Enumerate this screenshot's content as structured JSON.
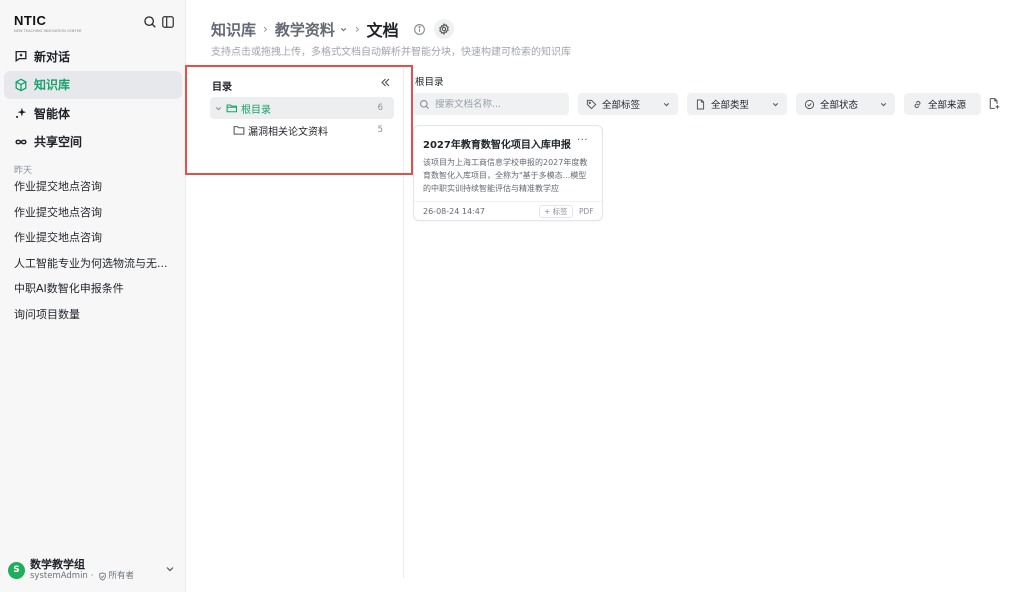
{
  "app": {
    "logo_text": "NTIC",
    "logo_tagline": "NEW TEACHING INNOVATION CENTER"
  },
  "nav": {
    "items": [
      {
        "label": "新对话",
        "icon": "chat-icon"
      },
      {
        "label": "知识库",
        "icon": "cube-icon",
        "active": true
      },
      {
        "label": "智能体",
        "icon": "sparkle-icon"
      },
      {
        "label": "共享空间",
        "icon": "infinity-icon"
      }
    ]
  },
  "history": {
    "group_label": "昨天",
    "items": [
      "作业提交地点咨询",
      "作业提交地点咨询",
      "作业提交地点咨询",
      "人工智能专业为何选物流与无...",
      "中职AI数智化申报条件",
      "询问项目数量"
    ]
  },
  "user": {
    "avatar_letter": "S",
    "name": "数学教学组",
    "account": "systemAdmin",
    "separator": "·",
    "role": "所有者"
  },
  "header": {
    "crumb_root": "知识库",
    "crumb_mid": "教学资料",
    "crumb_current": "文档",
    "subtitle": "支持点击或拖拽上传，多格式文档自动解析并智能分块，快速构建可检索的知识库"
  },
  "directory": {
    "title": "目录",
    "tree": [
      {
        "label": "根目录",
        "count": "6",
        "selected": true
      },
      {
        "label": "漏洞相关论文资料",
        "count": "5"
      }
    ]
  },
  "content": {
    "path_label": "根目录",
    "search_placeholder": "搜索文档名称...",
    "filters": [
      "全部标签",
      "全部类型",
      "全部状态",
      "全部来源"
    ]
  },
  "documents": [
    {
      "title": "2027年教育数智化项目入库申报",
      "more": "···",
      "description": "该项目为上海工商信息学校申报的2027年度教育数智化入库项目，全称为\"基于多模态...模型的中职实训持续智能评估与精准教学应",
      "date": "26-08-24 14:47",
      "tag_action": "+ 标签",
      "type": "PDF"
    }
  ],
  "colors": {
    "accent": "#17a36b",
    "highlight_border": "#e0524d",
    "sidebar_bg": "#f7f7f8"
  }
}
